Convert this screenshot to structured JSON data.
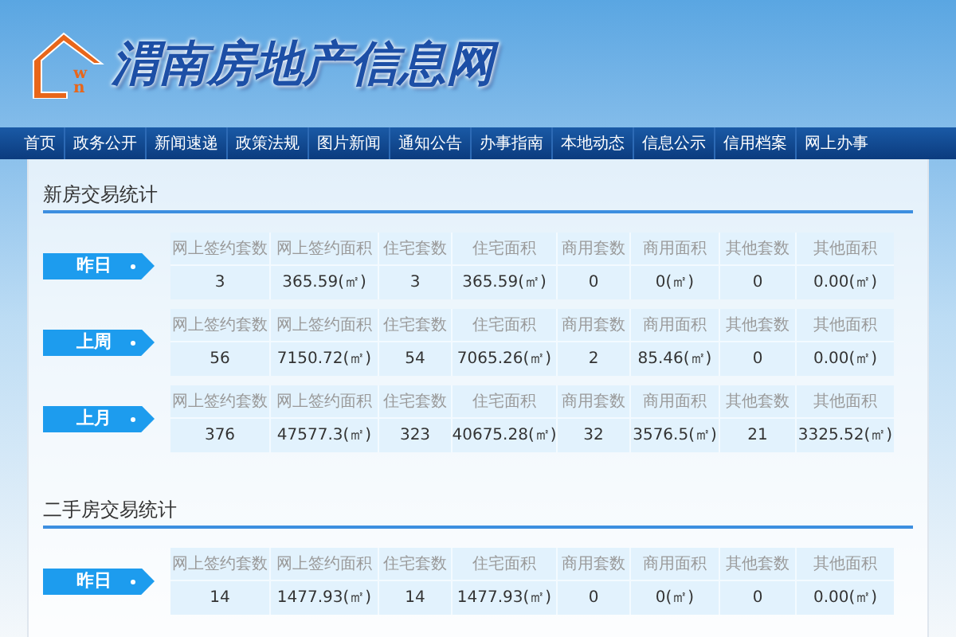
{
  "site": {
    "logo_mark": "wn",
    "title": "渭南房地产信息网"
  },
  "nav": [
    "首页",
    "政务公开",
    "新闻速递",
    "政策法规",
    "图片新闻",
    "通知公告",
    "办事指南",
    "本地动态",
    "信息公示",
    "信用档案",
    "网上办事"
  ],
  "sections": [
    {
      "title": "新房交易统计",
      "tables": [
        {
          "period": "昨日",
          "columns": [
            "网上签约套数",
            "网上签约面积",
            "住宅套数",
            "住宅面积",
            "商用套数",
            "商用面积",
            "其他套数",
            "其他面积"
          ],
          "values": [
            "3",
            "365.59(㎡)",
            "3",
            "365.59(㎡)",
            "0",
            "0(㎡)",
            "0",
            "0.00(㎡)"
          ]
        },
        {
          "period": "上周",
          "columns": [
            "网上签约套数",
            "网上签约面积",
            "住宅套数",
            "住宅面积",
            "商用套数",
            "商用面积",
            "其他套数",
            "其他面积"
          ],
          "values": [
            "56",
            "7150.72(㎡)",
            "54",
            "7065.26(㎡)",
            "2",
            "85.46(㎡)",
            "0",
            "0.00(㎡)"
          ]
        },
        {
          "period": "上月",
          "columns": [
            "网上签约套数",
            "网上签约面积",
            "住宅套数",
            "住宅面积",
            "商用套数",
            "商用面积",
            "其他套数",
            "其他面积"
          ],
          "values": [
            "376",
            "47577.3(㎡)",
            "323",
            "40675.28(㎡)",
            "32",
            "3576.5(㎡)",
            "21",
            "3325.52(㎡)"
          ]
        }
      ]
    },
    {
      "title": "二手房交易统计",
      "tables": [
        {
          "period": "昨日",
          "columns": [
            "网上签约套数",
            "网上签约面积",
            "住宅套数",
            "住宅面积",
            "商用套数",
            "商用面积",
            "其他套数",
            "其他面积"
          ],
          "values": [
            "14",
            "1477.93(㎡)",
            "14",
            "1477.93(㎡)",
            "0",
            "0(㎡)",
            "0",
            "0.00(㎡)"
          ]
        }
      ]
    }
  ]
}
